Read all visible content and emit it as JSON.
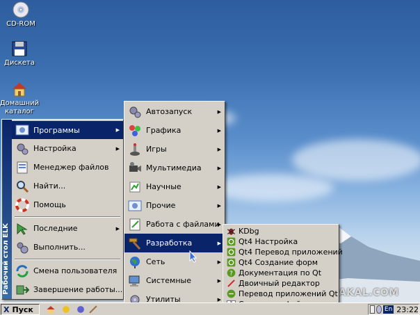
{
  "desktop": {
    "icons": [
      {
        "label": "CD-ROM",
        "icon": "cd-icon"
      },
      {
        "label": "Дискета",
        "icon": "floppy-icon"
      },
      {
        "label": "Домашний каталог",
        "icon": "home-folder-icon"
      }
    ],
    "watermark": "YAPLAKAL.COM"
  },
  "start_menu": {
    "sidebar_title": "Рабочий стол ELK",
    "items": [
      {
        "label": "Программы",
        "icon": "programs-icon",
        "submenu": true
      },
      {
        "label": "Настройка",
        "icon": "settings-icon",
        "submenu": true
      },
      {
        "label": "Менеджер файлов",
        "icon": "file-manager-icon",
        "submenu": false
      },
      {
        "label": "Найти...",
        "icon": "search-icon",
        "submenu": false
      },
      {
        "label": "Помощь",
        "icon": "help-icon",
        "submenu": false
      },
      {
        "label": "Последние",
        "icon": "recent-icon",
        "submenu": true
      },
      {
        "label": "Выполнить...",
        "icon": "run-icon",
        "submenu": false
      },
      {
        "label": "Смена пользователя",
        "icon": "switch-user-icon",
        "submenu": false
      },
      {
        "label": "Завершение работы...",
        "icon": "shutdown-icon",
        "submenu": false
      }
    ]
  },
  "programs_menu": {
    "items": [
      {
        "label": "Автозапуск",
        "icon": "autostart-icon"
      },
      {
        "label": "Графика",
        "icon": "graphics-icon"
      },
      {
        "label": "Игры",
        "icon": "games-icon"
      },
      {
        "label": "Мультимедиа",
        "icon": "multimedia-icon"
      },
      {
        "label": "Научные",
        "icon": "science-icon"
      },
      {
        "label": "Прочие",
        "icon": "other-icon"
      },
      {
        "label": "Работа с файлами",
        "icon": "files-icon"
      },
      {
        "label": "Разработка",
        "icon": "development-icon"
      },
      {
        "label": "Сеть",
        "icon": "network-icon"
      },
      {
        "label": "Системные",
        "icon": "system-icon"
      },
      {
        "label": "Утилиты",
        "icon": "utilities-icon"
      }
    ]
  },
  "development_menu": {
    "items": [
      {
        "label": "KDbg",
        "icon": "debugger-icon"
      },
      {
        "label": "Qt4 Настройка",
        "icon": "qt-icon"
      },
      {
        "label": "Qt4 Перевод приложений",
        "icon": "qt-icon"
      },
      {
        "label": "Qt4 Создание форм",
        "icon": "qt-icon"
      },
      {
        "label": "Документация по Qt",
        "icon": "qt-docs-icon"
      },
      {
        "label": "Двоичный редактор",
        "icon": "hex-editor-icon"
      },
      {
        "label": "Перевод приложений Qt",
        "icon": "qt-linguist-icon"
      },
      {
        "label": "Сравнение файлов",
        "icon": "diff-icon"
      }
    ]
  },
  "taskbar": {
    "start_label": "Пуск",
    "language": "En",
    "clock": "23:22"
  },
  "colors": {
    "menu_bg": "#d4d0c8",
    "selection": "#0a246a",
    "sidebar": "#0a246a"
  }
}
